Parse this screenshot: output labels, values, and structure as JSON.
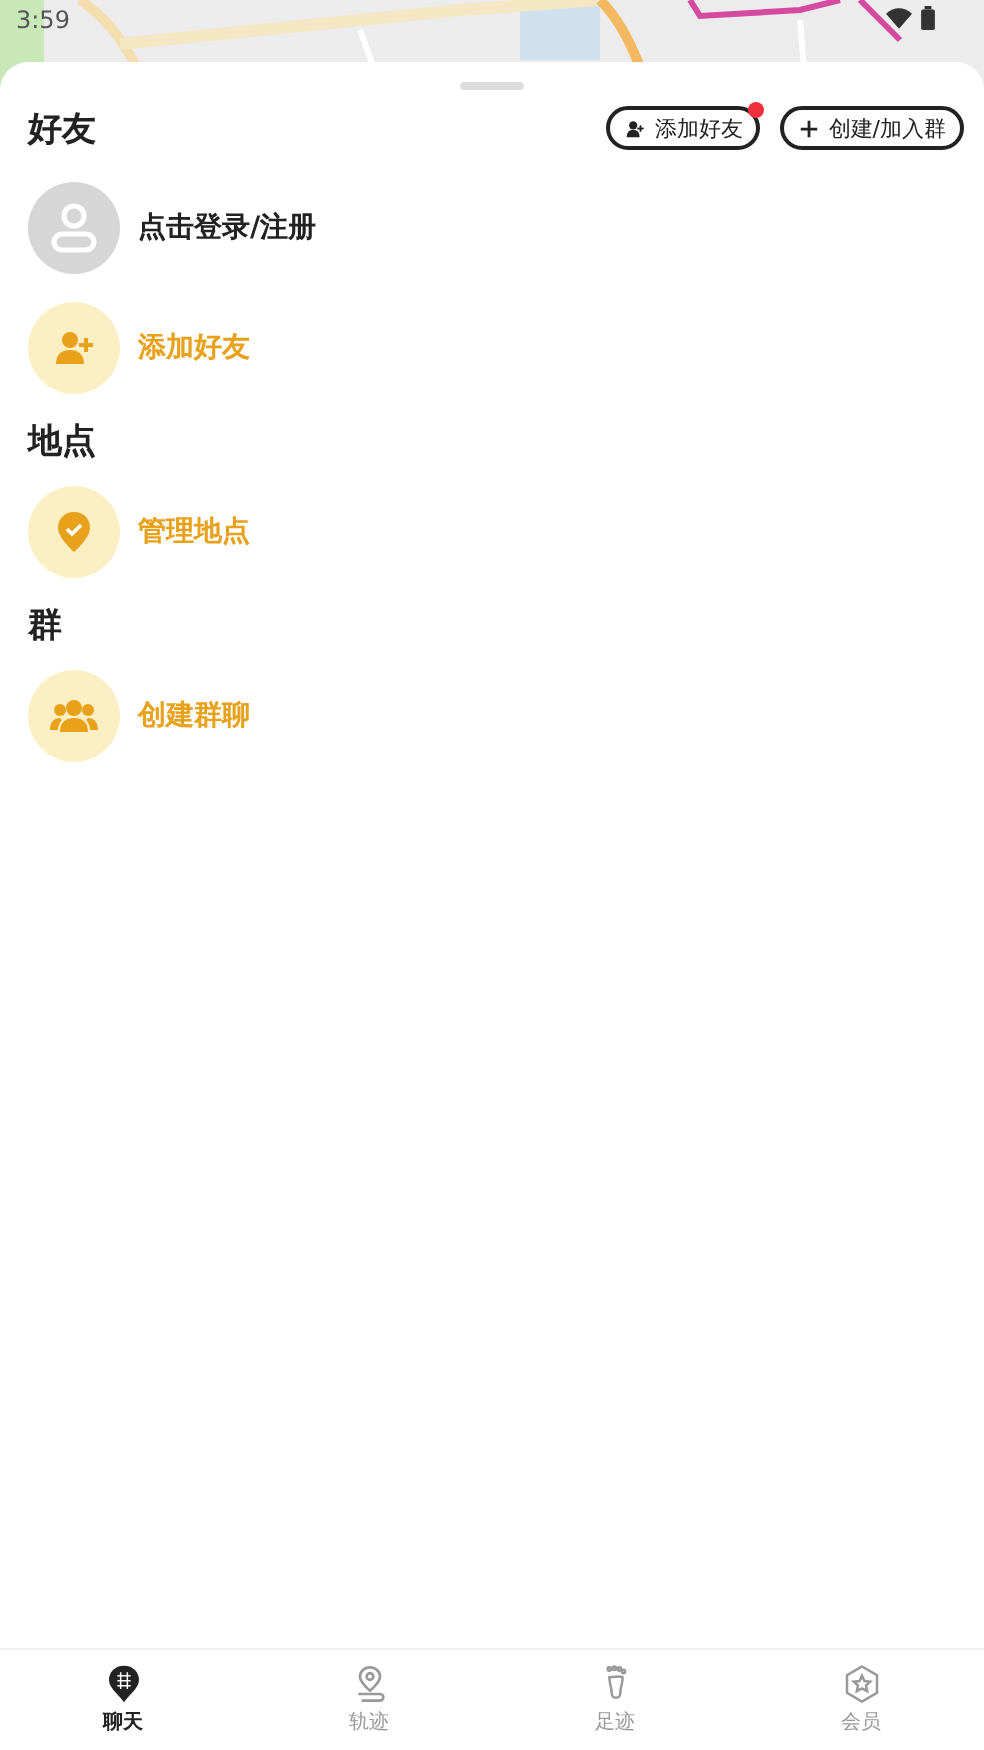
{
  "status_bar": {
    "time": "3:59"
  },
  "sections": [
    {
      "title": "好友",
      "buttons": [
        {
          "kind": "add-friend",
          "label": "添加好友",
          "badge": true
        },
        {
          "kind": "create-group",
          "label": "创建/加入群",
          "badge": false
        }
      ],
      "login": {
        "label": "点击登录/注册"
      },
      "items": [
        {
          "kind": "add-friend",
          "label": "添加好友"
        }
      ]
    },
    {
      "title": "地点",
      "items": [
        {
          "kind": "place",
          "label": "管理地点"
        }
      ]
    },
    {
      "title": "群",
      "items": [
        {
          "kind": "group",
          "label": "创建群聊"
        }
      ]
    }
  ],
  "tabs": [
    {
      "kind": "chat",
      "label": "聊天",
      "selected": true
    },
    {
      "kind": "track",
      "label": "轨迹",
      "selected": false
    },
    {
      "kind": "footprint",
      "label": "足迹",
      "selected": false
    },
    {
      "kind": "member",
      "label": "会员",
      "selected": false
    }
  ]
}
